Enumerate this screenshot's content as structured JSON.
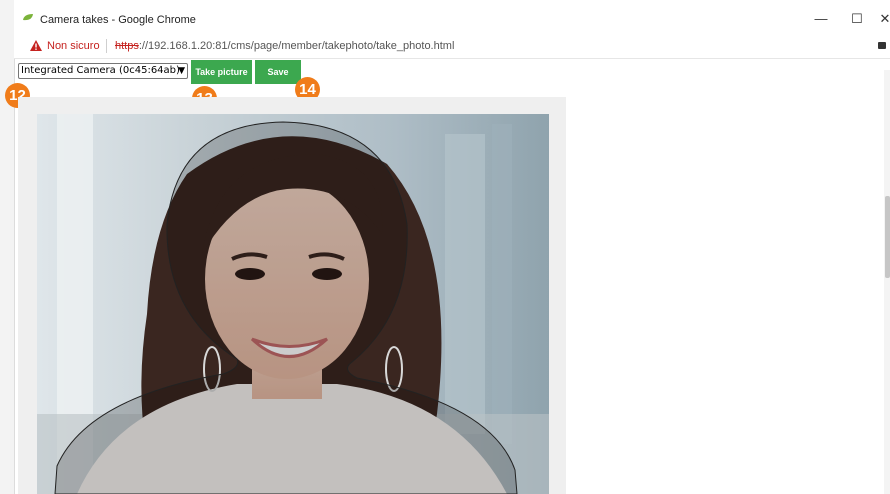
{
  "window": {
    "title": "Camera takes - Google Chrome",
    "controls": {
      "minimize": "—",
      "maximize": "☐",
      "close": "✕"
    }
  },
  "address_bar": {
    "security_label": "Non sicuro",
    "url_scheme": "https",
    "url_rest": "://192.168.1.20:81/cms/page/member/takephoto/take_photo.html"
  },
  "toolbar": {
    "camera_select_value": "Integrated Camera (0c45:64ab)",
    "take_picture_label": "Take picture",
    "save_label": "Save"
  },
  "callouts": {
    "camera_select": "12",
    "take_picture": "13",
    "save": "14"
  },
  "colors": {
    "button_green": "#3ca84f",
    "callout_orange": "#f07c1a",
    "warning_red": "#c5221f"
  },
  "icons": {
    "title": "chrome-app-icon",
    "warning": "warning-icon",
    "extension": "extension-icon"
  }
}
